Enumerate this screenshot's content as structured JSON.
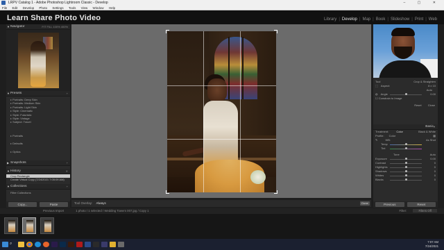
{
  "window": {
    "title": "LRPV Catalog 1 - Adobe Photoshop Lightroom Classic - Develop",
    "controls": "–  ▢  ✕"
  },
  "menu": [
    "File",
    "Edit",
    "Develop",
    "Photo",
    "Settings",
    "Tools",
    "View",
    "Window",
    "Help"
  ],
  "brand": "Learn Share Photo Video",
  "modules": [
    "Library",
    "Develop",
    "Map",
    "Book",
    "Slideshow",
    "Print",
    "Web"
  ],
  "active_module": "Develop",
  "left": {
    "navigator": {
      "label": "Navigator",
      "zoom_options": "FIT  FILL  100%  400%"
    },
    "presets": {
      "label": "Presets",
      "items": [
        "Portraits: Deep Skin",
        "Portraits: Medium Skin",
        "Portraits: Light Skin",
        "Style: Cinematic",
        "Style: Futuristic",
        "Style: Vintage",
        "Subject: Travel"
      ],
      "groups": [
        "Portraits",
        "Defaults",
        "Optics"
      ]
    },
    "snapshots": {
      "label": "Snapshots"
    },
    "history": {
      "label": "History",
      "items": [
        "Crop Rectangle",
        "Create Virtual Copy (7/24/2021 7:05:09 AM)"
      ],
      "selected_index": 0
    },
    "collections": {
      "label": "Collections",
      "items": [
        "Filter Collections"
      ]
    },
    "copy_label": "Copy...",
    "paste_label": "Paste"
  },
  "toolbar": {
    "tool_overlay": "Tool Overlay:",
    "tool_overlay_value": "Always",
    "done_label": "Done"
  },
  "right": {
    "tool_label": "Tool",
    "tool_name": "Crop & Straighten",
    "aspect_label": "Aspect:",
    "aspect_value": "8 x 10",
    "angle_label": "Angle",
    "angle_value": "0.00",
    "auto_label": "Auto",
    "constrain_label": "Constrain to Image",
    "reset_label": "Reset",
    "close_label": "Close",
    "basic_label": "Basic",
    "treatment_label": "Treatment:",
    "color_label": "Color",
    "bw_label": "Black & White",
    "profile_label": "Profile:",
    "profile_value": "Color",
    "wb_label": "WB:",
    "wb_value": "As Shot",
    "temp_label": "Temp",
    "tint_label": "Tint",
    "tone_label": "Tone",
    "tone_auto": "Auto",
    "sliders": [
      "Exposure",
      "Contrast",
      "Highlights",
      "Shadows",
      "Whites",
      "Blacks"
    ],
    "slider_values": [
      "0.00",
      "0",
      "0",
      "0",
      "0",
      "0"
    ],
    "previous_label": "Previous",
    "reset_button": "Reset"
  },
  "filmstrip": {
    "breadcrumb": "Previous Import",
    "path": "1 photo / 1 selected / Wedding Towers 007.jpg / Copy 1",
    "filter_label": "Filter:",
    "filter_value": "Filters Off",
    "count": 3,
    "selected_index": 1
  },
  "taskbar": {
    "time": "7:07 AM",
    "date": "7/24/2021",
    "apps": [
      "windows-icon",
      "search-icon",
      "explorer-icon",
      "chrome-icon",
      "edge-icon",
      "firefox-icon",
      "premiere-icon",
      "photoshop-icon",
      "illustrator-icon",
      "acrobat-icon",
      "lightroom-icon",
      "mail-icon",
      "store-icon",
      "folder-icon",
      "settings-icon"
    ]
  }
}
